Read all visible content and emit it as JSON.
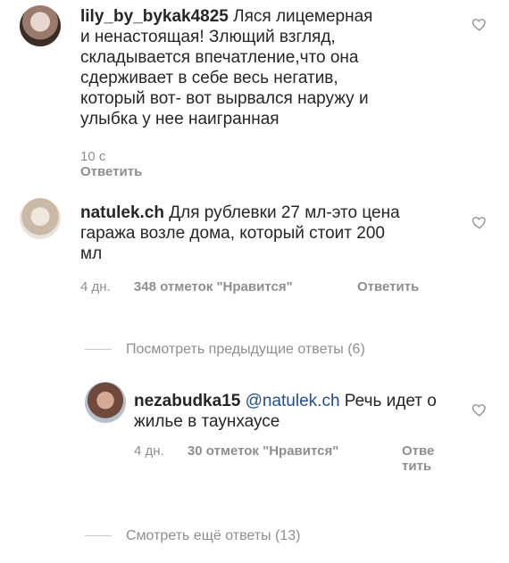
{
  "comments": [
    {
      "username": "lily_by_bykak4825",
      "text": "Ляся лицемерная и ненастоящая! Злющий взгляд, складывается впечатление,что она сдерживает в себе весь негатив, который вот- вот вырвался наружу и улыбка у нее наигранная",
      "time": "10 с",
      "reply": "Ответить"
    },
    {
      "username": "natulek.ch",
      "text": "Для рублевки 27 мл-это цена гаража возле дома, который стоит 200 мл",
      "time": "4 дн.",
      "likes": "348 отметок \"Нравится\"",
      "reply": "Ответить"
    },
    {
      "username": "nezabudka15",
      "mention": "@natulek.ch",
      "text": "Речь идет о жилье в таунхаусе",
      "time": "4 дн.",
      "likes": "30 отметок \"Нравится\"",
      "reply": "Ответить"
    }
  ],
  "view_previous_replies": "Посмотреть предыдущие ответы (6)",
  "view_more_replies": "Смотреть ещё ответы (13)",
  "icons": {
    "like": "heart-outline-icon"
  },
  "colors": {
    "text": "#262626",
    "secondary": "#8e8e8e",
    "mention": "#1f4f8c"
  }
}
